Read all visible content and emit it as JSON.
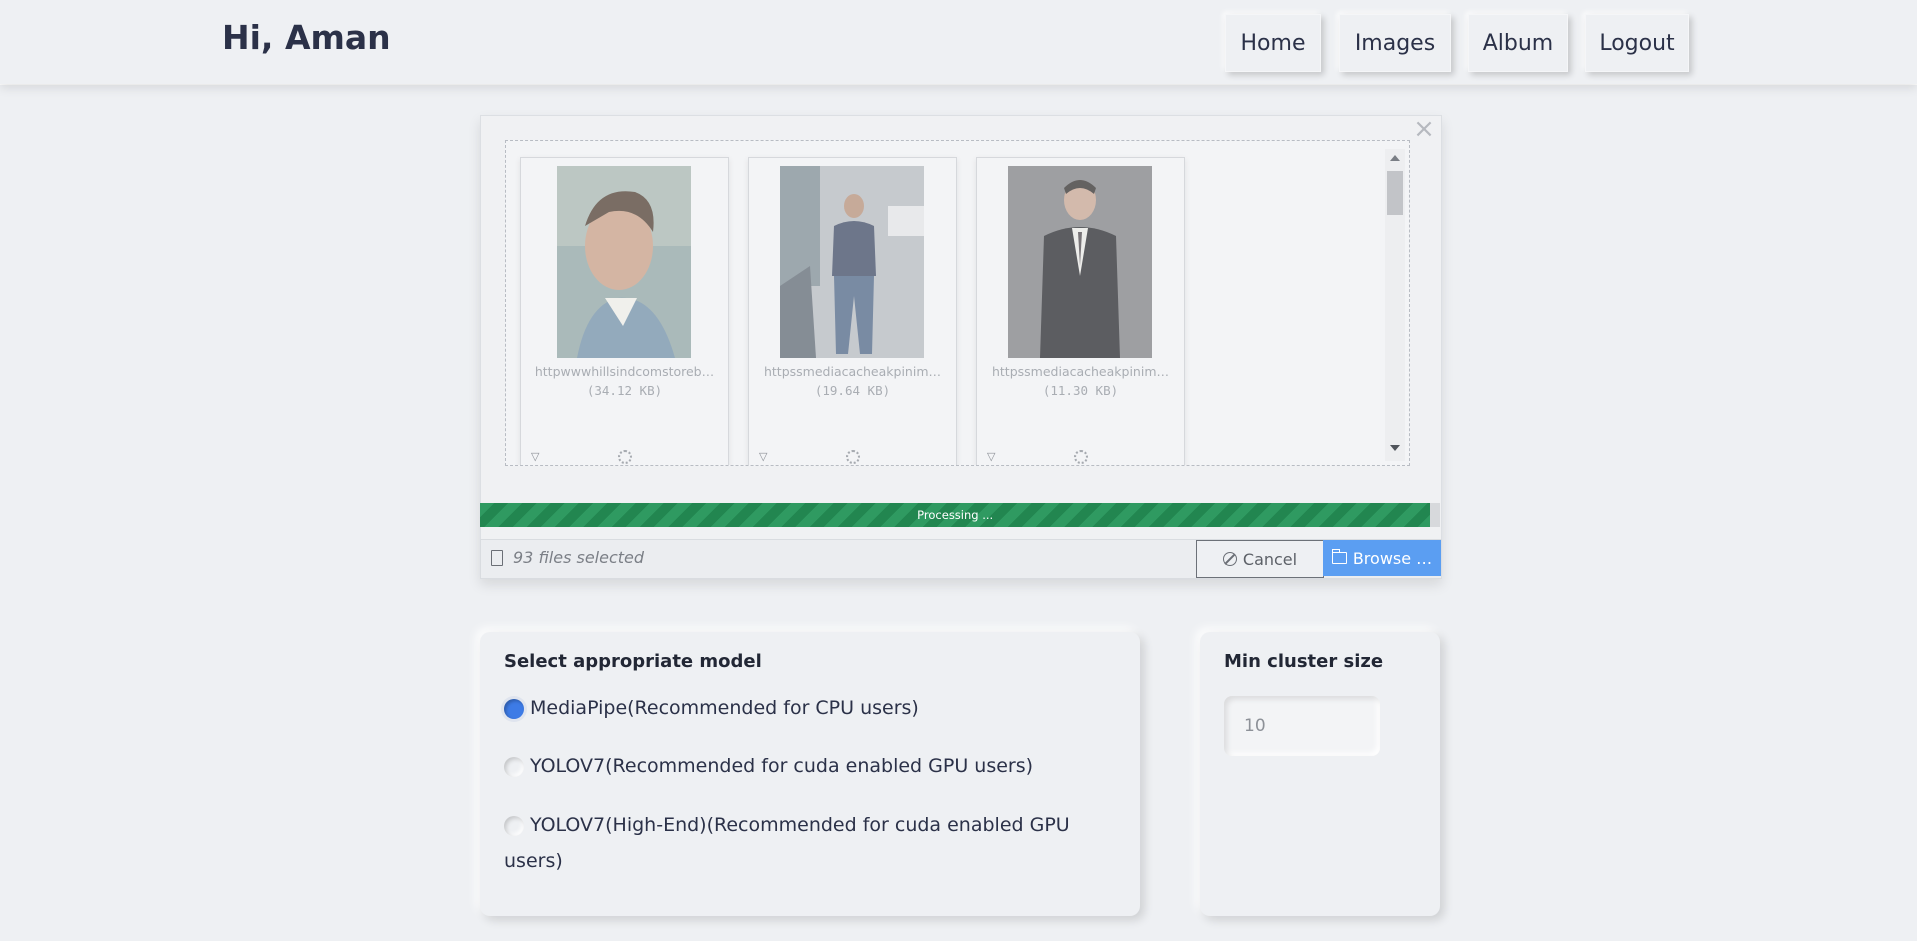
{
  "header": {
    "greeting": "Hi, Aman",
    "nav": [
      "Home",
      "Images",
      "Album",
      "Logout"
    ]
  },
  "upload": {
    "close_icon": "close-icon",
    "files": [
      {
        "name": "httpwwwhillsindcomstoreb…",
        "size": "(34.12 KB)"
      },
      {
        "name": "httpssmediacacheakpinim…",
        "size": "(19.64 KB)"
      },
      {
        "name": "httpssmediacacheakpinim…",
        "size": "(11.30 KB)"
      }
    ],
    "progress_label": "Processing ...",
    "progress_fraction": 0.99,
    "files_selected": "93 files selected",
    "cancel_label": "Cancel",
    "browse_label": "Browse …"
  },
  "model": {
    "title": "Select appropriate model",
    "options": [
      {
        "label": "MediaPipe(Recommended for CPU users)",
        "checked": true
      },
      {
        "label": "YOLOV7(Recommended for cuda enabled GPU users)",
        "checked": false
      },
      {
        "label": "YOLOV7(High-End)(Recommended for cuda enabled GPU users)",
        "checked": false
      }
    ]
  },
  "cluster": {
    "title": "Min cluster size",
    "placeholder": "10"
  },
  "colors": {
    "accent": "#5b9ef2",
    "progress": "#2f9a61",
    "radio_checked": "#3d7be6"
  }
}
